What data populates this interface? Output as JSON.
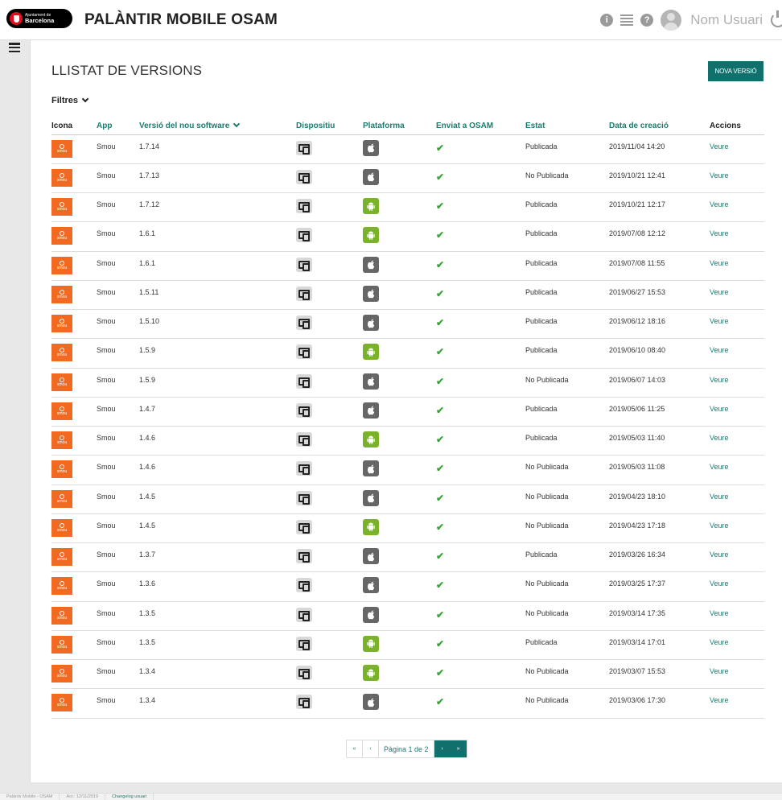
{
  "header": {
    "logo_line1": "Ajuntament de",
    "logo_line2": "Barcelona",
    "title": "PALÀNTIR MOBILE OSAM",
    "user_name": "Nom Usuari"
  },
  "page": {
    "title": "LLISTAT DE VERSIONS",
    "new_button": "NOVA VERSIÓ",
    "filters_label": "Filtres"
  },
  "table": {
    "headers": [
      "Icona",
      "App",
      "Versió del nou software",
      "Dispositiu",
      "Plataforma",
      "Enviat a OSAM",
      "Estat",
      "Data de creació",
      "Accions"
    ],
    "rows": [
      {
        "app": "Smou",
        "version": "1.7.14",
        "platform": "ios",
        "sent": "✔",
        "status": "Publicada",
        "date": "2019/11/04 14:20",
        "action": "Veure"
      },
      {
        "app": "Smou",
        "version": "1.7.13",
        "platform": "ios",
        "sent": "✔",
        "status": "No Publicada",
        "date": "2019/10/21 12:41",
        "action": "Veure"
      },
      {
        "app": "Smou",
        "version": "1.7.12",
        "platform": "android",
        "sent": "✔",
        "status": "Publicada",
        "date": "2019/10/21 12:17",
        "action": "Veure"
      },
      {
        "app": "Smou",
        "version": "1.6.1",
        "platform": "android",
        "sent": "✔",
        "status": "Publicada",
        "date": "2019/07/08 12:12",
        "action": "Veure"
      },
      {
        "app": "Smou",
        "version": "1.6.1",
        "platform": "ios",
        "sent": "✔",
        "status": "Publicada",
        "date": "2019/07/08 11:55",
        "action": "Veure"
      },
      {
        "app": "Smou",
        "version": "1.5.11",
        "platform": "ios",
        "sent": "✔",
        "status": "Publicada",
        "date": "2019/06/27 15:53",
        "action": "Veure"
      },
      {
        "app": "Smou",
        "version": "1.5.10",
        "platform": "ios",
        "sent": "✔",
        "status": "Publicada",
        "date": "2019/06/12 18:16",
        "action": "Veure"
      },
      {
        "app": "Smou",
        "version": "1.5.9",
        "platform": "android",
        "sent": "✔",
        "status": "Publicada",
        "date": "2019/06/10 08:40",
        "action": "Veure"
      },
      {
        "app": "Smou",
        "version": "1.5.9",
        "platform": "ios",
        "sent": "✔",
        "status": "No Publicada",
        "date": "2019/06/07 14:03",
        "action": "Veure"
      },
      {
        "app": "Smou",
        "version": "1.4.7",
        "platform": "ios",
        "sent": "✔",
        "status": "Publicada",
        "date": "2019/05/06 11:25",
        "action": "Veure"
      },
      {
        "app": "Smou",
        "version": "1.4.6",
        "platform": "android",
        "sent": "✔",
        "status": "Publicada",
        "date": "2019/05/03 11:40",
        "action": "Veure"
      },
      {
        "app": "Smou",
        "version": "1.4.6",
        "platform": "ios",
        "sent": "✔",
        "status": "No Publicada",
        "date": "2019/05/03 11:08",
        "action": "Veure"
      },
      {
        "app": "Smou",
        "version": "1.4.5",
        "platform": "ios",
        "sent": "✔",
        "status": "No Publicada",
        "date": "2019/04/23 18:10",
        "action": "Veure"
      },
      {
        "app": "Smou",
        "version": "1.4.5",
        "platform": "android",
        "sent": "✔",
        "status": "No Publicada",
        "date": "2019/04/23 17:18",
        "action": "Veure"
      },
      {
        "app": "Smou",
        "version": "1.3.7",
        "platform": "ios",
        "sent": "✔",
        "status": "Publicada",
        "date": "2019/03/26 16:34",
        "action": "Veure"
      },
      {
        "app": "Smou",
        "version": "1.3.6",
        "platform": "ios",
        "sent": "✔",
        "status": "No Publicada",
        "date": "2019/03/25 17:37",
        "action": "Veure"
      },
      {
        "app": "Smou",
        "version": "1.3.5",
        "platform": "ios",
        "sent": "✔",
        "status": "No Publicada",
        "date": "2019/03/14 17:35",
        "action": "Veure"
      },
      {
        "app": "Smou",
        "version": "1.3.5",
        "platform": "android",
        "sent": "✔",
        "status": "Publicada",
        "date": "2019/03/14 17:01",
        "action": "Veure"
      },
      {
        "app": "Smou",
        "version": "1.3.4",
        "platform": "android",
        "sent": "✔",
        "status": "No Publicada",
        "date": "2019/03/07 15:53",
        "action": "Veure"
      },
      {
        "app": "Smou",
        "version": "1.3.4",
        "platform": "ios",
        "sent": "✔",
        "status": "No Publicada",
        "date": "2019/03/06 17:30",
        "action": "Veure"
      }
    ]
  },
  "pagination": {
    "first": "«",
    "prev": "‹",
    "label": "Pàgina 1 de 2",
    "next": "›",
    "last": "»"
  },
  "footer": {
    "app": "Palàntir Mobile - OSAM",
    "updated": "Act.: 12/11/2019",
    "changelog": "Changelog usuari"
  },
  "colors": {
    "accent": "#11706b",
    "link": "#1d7a6f",
    "app_icon": "#f26a21",
    "android": "#7ab32a",
    "ios": "#666666",
    "check": "#3aa33a"
  },
  "icons": {
    "app_icon_text": "smou"
  }
}
